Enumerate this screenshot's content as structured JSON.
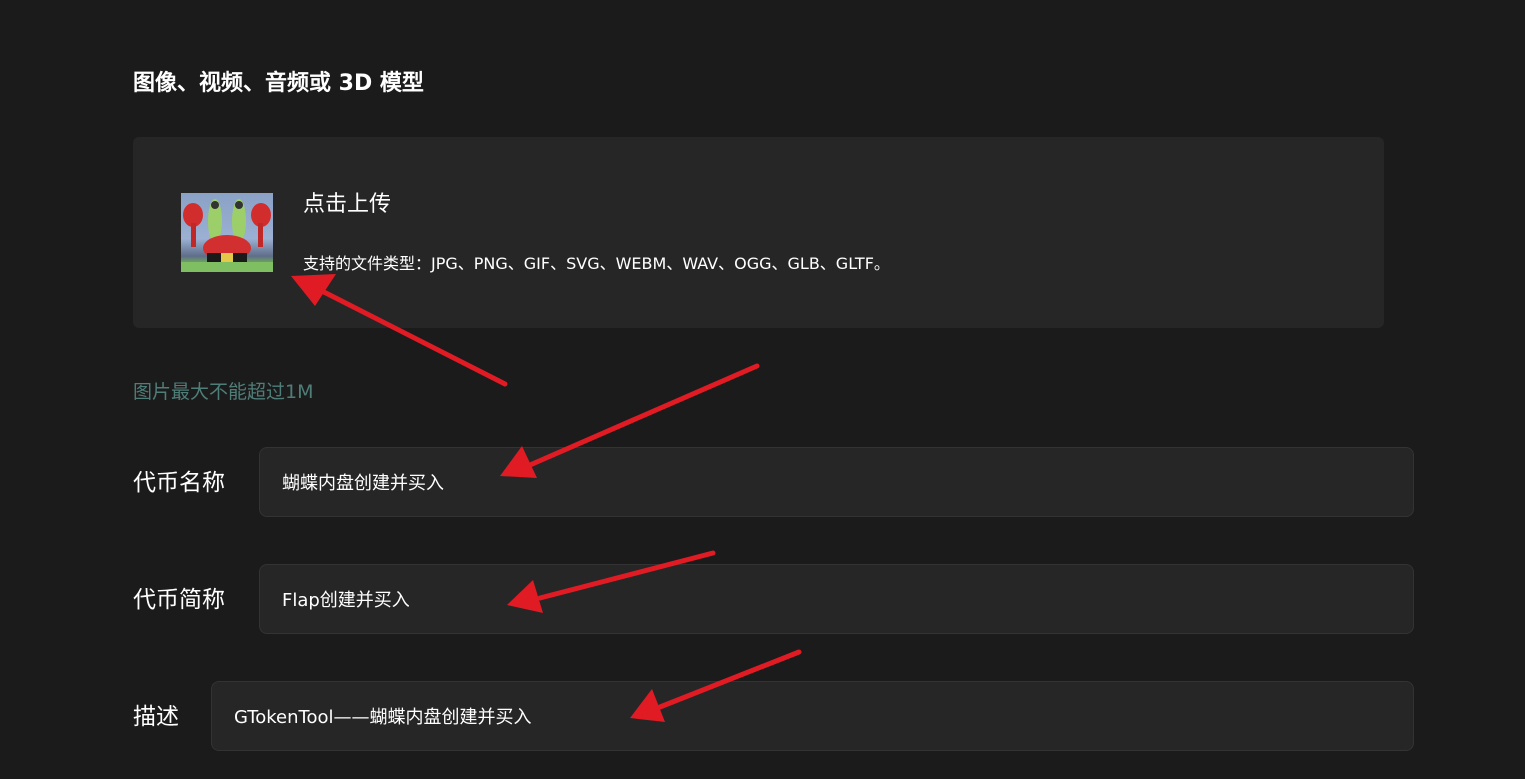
{
  "section": {
    "title": "图像、视频、音频或 3D 模型"
  },
  "upload": {
    "title": "点击上传",
    "types": "支持的文件类型：JPG、PNG、GIF、SVG、WEBM、WAV、OGG、GLB、GLTF。",
    "size_hint": "图片最大不能超过1M"
  },
  "form": {
    "name_label": "代币名称",
    "name_value": "蝴蝶内盘创建并买入",
    "symbol_label": "代币简称",
    "symbol_value": "Flap创建并买入",
    "description_label": "描述",
    "description_value": "GTokenTool——蝴蝶内盘创建并买入"
  },
  "colors": {
    "background": "#1b1b1b",
    "panel": "#262626",
    "hint": "#4f7d78",
    "annotation_arrow": "#e01b24"
  }
}
